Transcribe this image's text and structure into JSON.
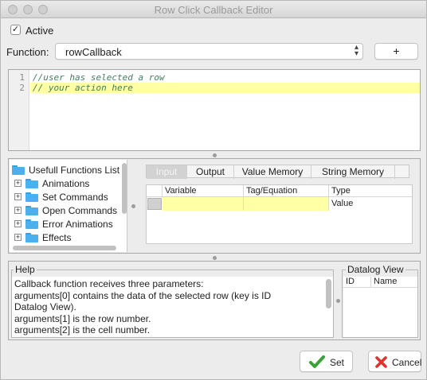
{
  "window": {
    "title": "Row Click Callback Editor"
  },
  "active": {
    "label": "Active",
    "checked": true,
    "mark": "✓"
  },
  "function": {
    "label": "Function:",
    "value": "rowCallback",
    "add_label": "+"
  },
  "editor": {
    "lines": [
      {
        "num": "1",
        "text": "//user has selected a row"
      },
      {
        "num": "2",
        "text": "// your action here"
      }
    ]
  },
  "functions_tree": {
    "root": "Usefull Functions List",
    "items": [
      "Animations",
      "Set Commands",
      "Open Commands",
      "Error Animations",
      "Effects"
    ]
  },
  "tabs": [
    "Input",
    "Output",
    "Value Memory",
    "String Memory"
  ],
  "variables_table": {
    "headers": [
      "Variable",
      "Tag/Equation",
      "Type"
    ],
    "rows": [
      {
        "variable": "",
        "tag": "",
        "type": "Value"
      }
    ]
  },
  "help": {
    "title": "Help",
    "lines": [
      "Callback function receives three parameters:",
      "arguments[0] contains the data of the selected row (key is ID",
      "Datalog View).",
      "arguments[1] is the row number.",
      "arguments[2] is the cell number."
    ]
  },
  "datalog": {
    "title": "Datalog View",
    "headers": [
      "ID",
      "Name"
    ]
  },
  "buttons": {
    "set_label": "Set",
    "cancel_label": "Cancel"
  },
  "colors": {
    "highlight_line": "#ffffa6",
    "comment": "#3f7f5f",
    "folder": "#4ab1ee",
    "check_green": "#3aa335",
    "cancel_red": "#e0322d"
  }
}
